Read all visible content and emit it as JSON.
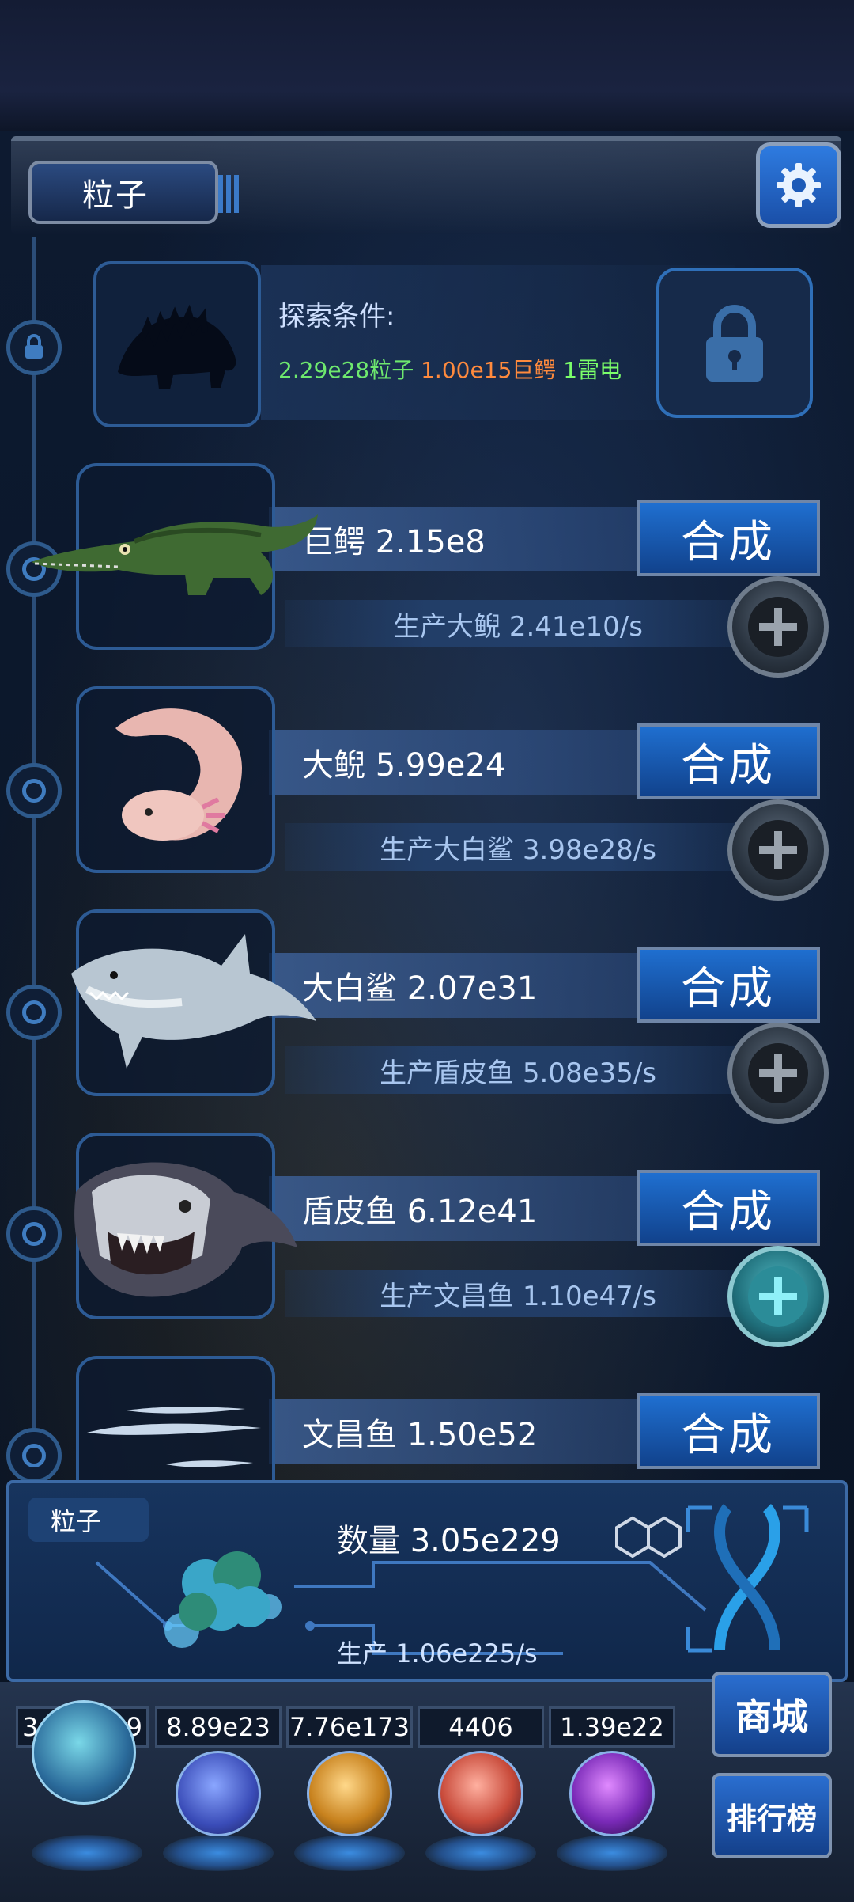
{
  "header": {
    "title": "粒子",
    "settings_icon": "gear-icon"
  },
  "locked_creature": {
    "explore_label": "探索条件:",
    "conditions": [
      {
        "text": "2.29e28粒子",
        "color": "#6ee86e"
      },
      {
        "text": "1.00e15巨鳄",
        "color": "#ff8a3d"
      },
      {
        "text": "1雷电",
        "color": "#7bff6a"
      }
    ],
    "lock_icon": "lock-icon"
  },
  "creatures": [
    {
      "name": "巨鳄 2.15e8",
      "combine_label": "合成",
      "production": "生产大鲵 2.41e10/s",
      "icon": "crocodile-icon",
      "plus_active": false
    },
    {
      "name": "大鲵 5.99e24",
      "combine_label": "合成",
      "production": "生产大白鲨 3.98e28/s",
      "icon": "axolotl-icon",
      "plus_active": false
    },
    {
      "name": "大白鲨 2.07e31",
      "combine_label": "合成",
      "production": "生产盾皮鱼 5.08e35/s",
      "icon": "shark-icon",
      "plus_active": false
    },
    {
      "name": "盾皮鱼 6.12e41",
      "combine_label": "合成",
      "production": "生产文昌鱼 1.10e47/s",
      "icon": "dunkleosteus-icon",
      "plus_active": true
    },
    {
      "name": "文昌鱼 1.50e52",
      "combine_label": "合成",
      "production": "",
      "icon": "lancelet-icon",
      "plus_active": false
    }
  ],
  "particle_panel": {
    "tag": "粒子",
    "count": "数量 3.05e229",
    "rate": "生产 1.06e225/s",
    "icon": "particle-cluster-icon",
    "dna_icon": "dna-icon"
  },
  "resources": [
    {
      "value": "3.05e229",
      "icon": "particle-orb-icon"
    },
    {
      "value": "8.89e23",
      "icon": "lightning-orb-icon"
    },
    {
      "value": "7.76e173",
      "icon": "fire-orb-icon"
    },
    {
      "value": "4406",
      "icon": "brain-orb-icon"
    },
    {
      "value": "1.39e22",
      "icon": "vortex-orb-icon"
    }
  ],
  "side_buttons": {
    "shop_label": "商城",
    "rank_label": "排行榜"
  },
  "colors": {
    "accent": "#1f6fd0",
    "condition_green": "#6ee86e",
    "condition_orange": "#ff8a3d"
  }
}
